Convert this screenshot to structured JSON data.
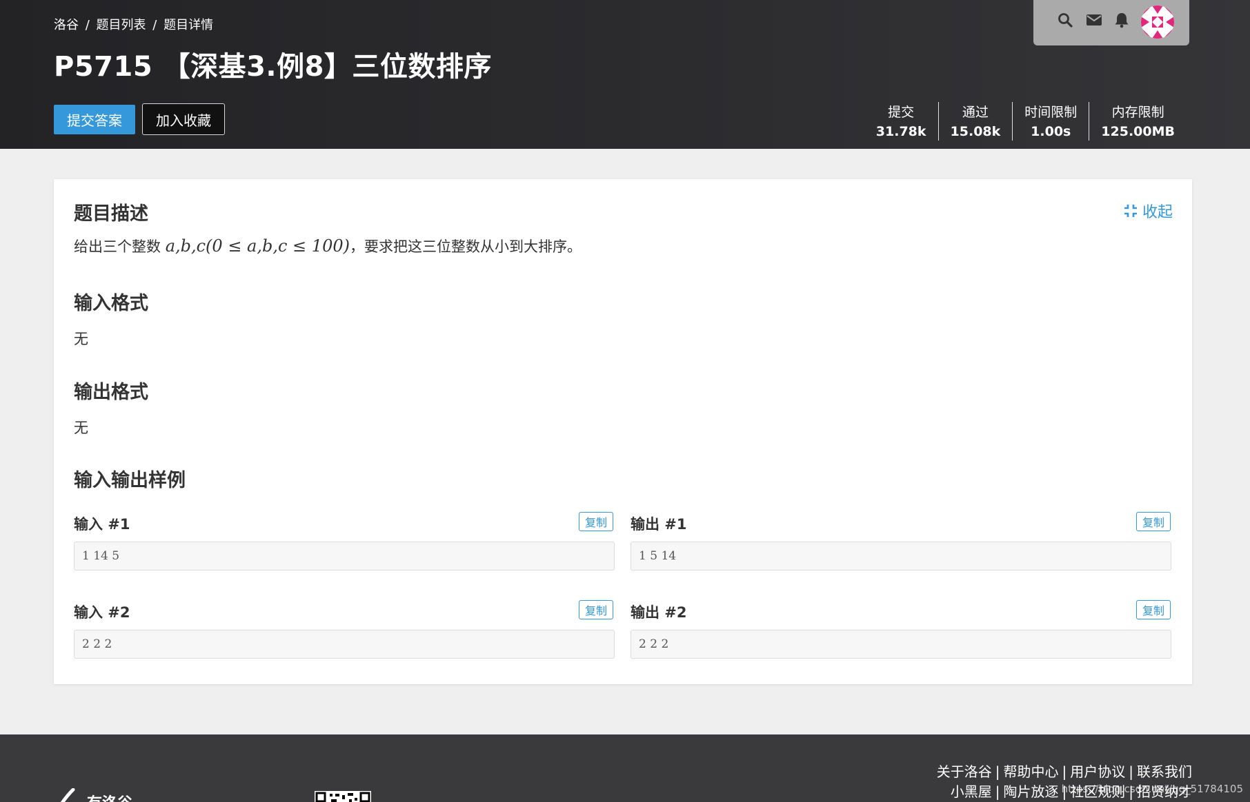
{
  "header": {
    "breadcrumb": [
      "洛谷",
      "题目列表",
      "题目详情"
    ],
    "breadcrumb_separator": "/",
    "title": "P5715 【深基3.例8】三位数排序",
    "submit_label": "提交答案",
    "favorite_label": "加入收藏",
    "stats": [
      {
        "label": "提交",
        "value": "31.78k"
      },
      {
        "label": "通过",
        "value": "15.08k"
      },
      {
        "label": "时间限制",
        "value": "1.00s"
      },
      {
        "label": "内存限制",
        "value": "125.00MB"
      }
    ],
    "user_icons": [
      "search-icon",
      "mail-icon",
      "bell-icon"
    ],
    "avatar_color": "#e0297a"
  },
  "problem": {
    "collapse_label": "收起",
    "description": {
      "heading": "题目描述",
      "text_before": "给出三个整数",
      "math": "a,b,c(0 ≤ a,b,c ≤ 100)",
      "text_after": "，要求把这三位整数从小到大排序。"
    },
    "input_format": {
      "heading": "输入格式",
      "text": "无"
    },
    "output_format": {
      "heading": "输出格式",
      "text": "无"
    },
    "samples_heading": "输入输出样例",
    "copy_label": "复制",
    "samples": [
      {
        "input_label": "输入 #1",
        "input": "1 14 5",
        "output_label": "输出 #1",
        "output": "1 5 14"
      },
      {
        "input_label": "输入 #2",
        "input": "2 2 2",
        "output_label": "输出 #2",
        "output": "2 2 2"
      }
    ]
  },
  "footer": {
    "links_row1": [
      "关于洛谷",
      "帮助中心",
      "用户协议",
      "联系我们"
    ],
    "links_row2": [
      "小黑屋",
      "陶片放逐",
      "社区规则",
      "招贤纳才"
    ],
    "separator": "|",
    "logo_text": "有洛谷",
    "watermark": "https://blog.csdn.net/qq_51784105"
  },
  "colors": {
    "accent": "#3498db",
    "header_bg": "#2c2c2f",
    "page_bg": "#efefef",
    "footer_bg": "#3a3a3c"
  }
}
